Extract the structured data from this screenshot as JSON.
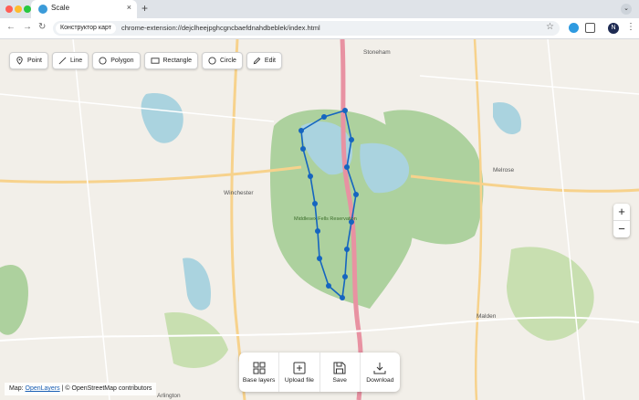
{
  "browser": {
    "tab_title": "Scale",
    "tab_close": "×",
    "new_tab": "+",
    "tab_menu": "⌄",
    "back": "←",
    "forward": "→",
    "reload": "↻",
    "site_chip": "Конструктор карт",
    "url": "chrome-extension://dejclheejpghcgncbaefdnahdbeblek/index.html",
    "bookmark": "☆",
    "avatar": "N",
    "menu": "⋮"
  },
  "draw_tools": [
    {
      "label": "Point",
      "icon": "map-pin-icon"
    },
    {
      "label": "Line",
      "icon": "line-icon"
    },
    {
      "label": "Polygon",
      "icon": "polygon-icon"
    },
    {
      "label": "Rectangle",
      "icon": "rectangle-icon"
    },
    {
      "label": "Circle",
      "icon": "circle-icon"
    },
    {
      "label": "Edit",
      "icon": "pencil-icon"
    }
  ],
  "zoom": {
    "in": "+",
    "out": "−"
  },
  "actions": [
    {
      "label": "Base layers",
      "icon": "layers-icon"
    },
    {
      "label": "Upload file",
      "icon": "upload-icon"
    },
    {
      "label": "Save",
      "icon": "save-icon"
    },
    {
      "label": "Download",
      "icon": "download-icon"
    }
  ],
  "attribution": {
    "prefix": "Map:",
    "link": "OpenLayers",
    "separator": "|",
    "credit": "© OpenStreetMap contributors"
  },
  "map": {
    "places": [
      "Stoneham",
      "Melrose",
      "Winchester",
      "Middlesex Fells Reservation",
      "Malden",
      "Arlington"
    ],
    "colors": {
      "land": "#f2efe9",
      "park": "#add19e",
      "water": "#aad3df",
      "road_major": "#e892a2",
      "road_secondary": "#f7d28c",
      "route": "#1565c0"
    }
  }
}
